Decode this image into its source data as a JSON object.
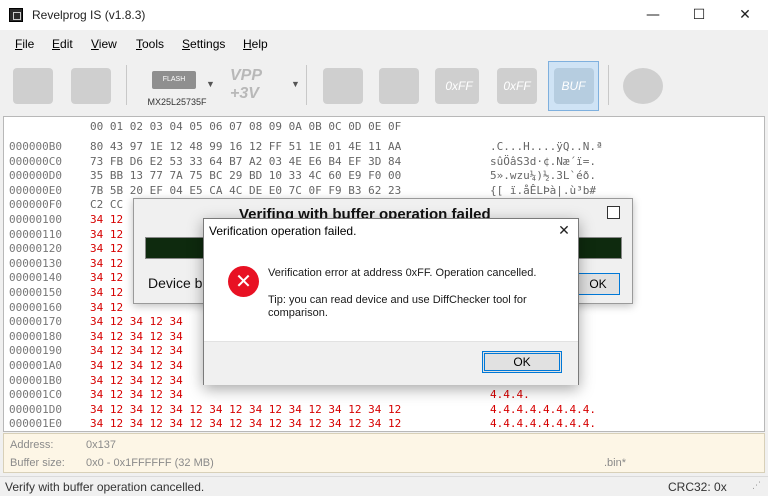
{
  "window": {
    "title": "Revelprog IS (v1.8.3)",
    "caption_buttons": {
      "minimize": "—",
      "maximize": "☐",
      "close": "✕"
    }
  },
  "menu": [
    {
      "label": "File"
    },
    {
      "label": "Edit"
    },
    {
      "label": "View"
    },
    {
      "label": "Tools"
    },
    {
      "label": "Settings"
    },
    {
      "label": "Help"
    }
  ],
  "toolbar": {
    "device_chip_text": "FLASH",
    "device_label": "MX25L25735F",
    "vpp_label": "VPP",
    "voltage_label": "+3V",
    "dropdown_caret": "▼",
    "blank_ff_label": "0xFF",
    "verify_ff_label": "0xFF",
    "buf_label": "BUF"
  },
  "hex": {
    "header": "00 01 02 03 04 05 06 07 08 09 0A 0B 0C 0D 0E 0F",
    "rows": [
      {
        "addr": "000000B0",
        "bytes": "80 43 97 1E 12 48 99 16 12 FF 51 1E 01 4E 11 AA",
        "ascii": ".C...H....ÿQ..N.ª",
        "err": false
      },
      {
        "addr": "000000C0",
        "bytes": "73 FB D6 E2 53 33 64 B7 A2 03 4E E6 B4 EF 3D 84",
        "ascii": "sûÖâS3d·¢.Næ´ï=.",
        "err": false
      },
      {
        "addr": "000000D0",
        "bytes": "35 BB 13 77 7A 75 BC 29 BD 10 33 4C 60 E9 F0 00",
        "ascii": "5».wzu¼)½.3L`éð.",
        "err": false
      },
      {
        "addr": "000000E0",
        "bytes": "7B 5B 20 EF 04 E5 CA 4C DE E0 7C 0F F9 B3 62 23",
        "ascii": "{[ ï.åÊLÞà|.ù³b#",
        "err": false
      },
      {
        "addr": "000000F0",
        "bytes": "C2 CC",
        "ascii": "",
        "err": false
      },
      {
        "addr": "00000100",
        "bytes": "34 12",
        "ascii": "",
        "err": true
      },
      {
        "addr": "00000110",
        "bytes": "34 12",
        "ascii": "",
        "err": true
      },
      {
        "addr": "00000120",
        "bytes": "34 12",
        "ascii": "",
        "err": true
      },
      {
        "addr": "00000130",
        "bytes": "34 12",
        "ascii": "",
        "err": true
      },
      {
        "addr": "00000140",
        "bytes": "34 12",
        "ascii": "",
        "err": true
      },
      {
        "addr": "00000150",
        "bytes": "34 12",
        "ascii": "",
        "err": true
      },
      {
        "addr": "00000160",
        "bytes": "34 12",
        "ascii": "",
        "err": true
      },
      {
        "addr": "00000170",
        "bytes": "34 12 34 12 34",
        "ascii": "4.4.4.",
        "err": true
      },
      {
        "addr": "00000180",
        "bytes": "34 12 34 12 34",
        "ascii": "4.4.4.",
        "err": true
      },
      {
        "addr": "00000190",
        "bytes": "34 12 34 12 34",
        "ascii": "4.4.4.",
        "err": true
      },
      {
        "addr": "000001A0",
        "bytes": "34 12 34 12 34",
        "ascii": "4.4.4.",
        "err": true
      },
      {
        "addr": "000001B0",
        "bytes": "34 12 34 12 34",
        "ascii": "4.4.4.",
        "err": true
      },
      {
        "addr": "000001C0",
        "bytes": "34 12 34 12 34",
        "ascii": "4.4.4.",
        "err": true
      },
      {
        "addr": "000001D0",
        "bytes": "34 12 34 12 34 12 34 12 34 12 34 12 34 12 34 12",
        "ascii": "4.4.4.4.4.4.4.4.",
        "err": true
      },
      {
        "addr": "000001E0",
        "bytes": "34 12 34 12 34 12 34 12 34 12 34 12 34 12 34 12",
        "ascii": "4.4.4.4.4.4.4.4.",
        "err": true
      },
      {
        "addr": "000001F0",
        "bytes": "34 12 34 12 34 12 34 12 34 12 34 12 34 12 34 12",
        "ascii": "4.4.4.4.4.4.4.4.",
        "err": true
      }
    ]
  },
  "info": {
    "address_label": "Address:",
    "address_value": "0x137",
    "buffer_label": "Buffer size:",
    "buffer_value": "0x0 - 0x1FFFFFF (32 MB)",
    "file_suffix": ".bin*"
  },
  "status": {
    "message": "Verify with buffer operation cancelled.",
    "crc": "CRC32: 0x",
    "grip": "⋰"
  },
  "progress_dialog": {
    "title": "Verifing with buffer operation failed",
    "status_text": "Device bu",
    "ok_label": "OK"
  },
  "error_dialog": {
    "title": "Verification operation failed.",
    "close_glyph": "✕",
    "icon_glyph": "✕",
    "message": "Verification error at address 0xFF. Operation cancelled.",
    "tip": "Tip: you can read device and use DiffChecker tool for comparison.",
    "ok_label": "OK"
  },
  "colors": {
    "error_red": "#d60000",
    "error_icon": "#e81123",
    "accent_blue": "#0078d7"
  }
}
